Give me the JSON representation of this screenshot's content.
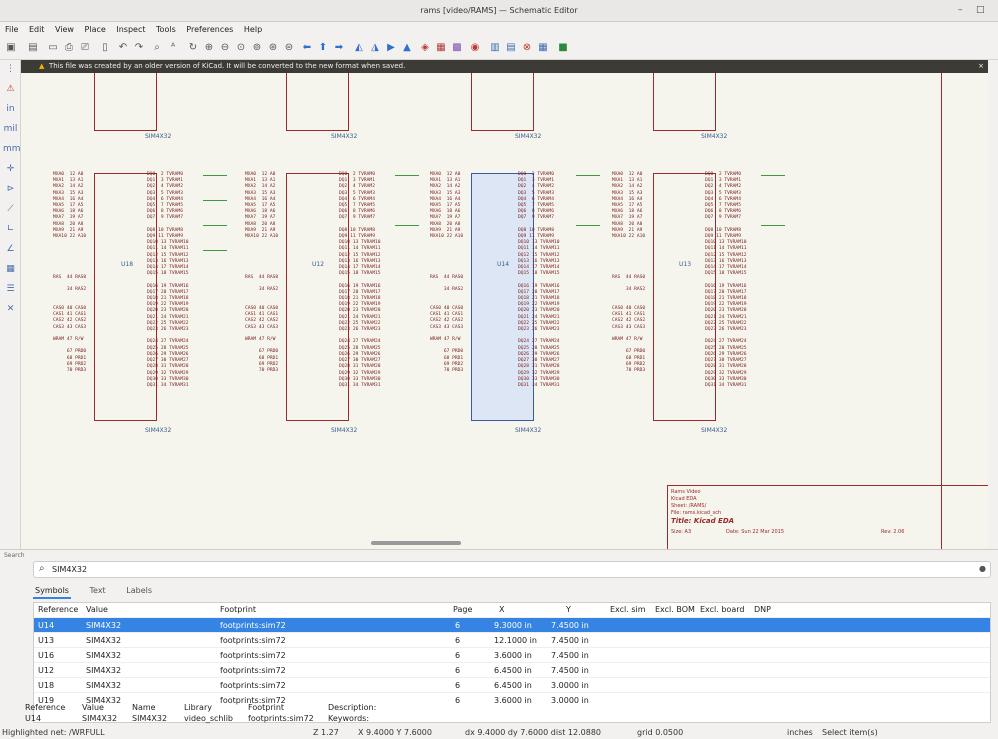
{
  "window": {
    "title": "rams [video/RAMS] — Schematic Editor",
    "minimize": "–",
    "maximize": "□"
  },
  "menu": [
    "File",
    "Edit",
    "View",
    "Place",
    "Inspect",
    "Tools",
    "Preferences",
    "Help"
  ],
  "warning": {
    "text": "This file was created by an older version of KiCad. It will be converted to the new format when saved.",
    "close": "×",
    "icon": "warning-icon"
  },
  "components": [
    {
      "ref": "U18",
      "value": "SIM4X32"
    },
    {
      "ref": "U12",
      "value": "SIM4X32"
    },
    {
      "ref": "U14",
      "value": "SIM4X32"
    },
    {
      "ref": "U13",
      "value": "SIM4X32"
    }
  ],
  "top_labels": [
    "SIM4X32",
    "SIM4X32",
    "SIM4X32",
    "SIM4X32"
  ],
  "titleblock": {
    "company": "Rams Video",
    "comment": "Kicad EDA",
    "sheet": "Sheet: /RAMS/",
    "file": "File: rams.kicad_sch",
    "title": "Title: Kicad EDA",
    "size": "Size: A3",
    "date": "Date: Sun 22 Mar 2015",
    "rev": "Rev: 2.06"
  },
  "search": {
    "header": "Search",
    "query": "SIM4X32",
    "tabs": [
      "Symbols",
      "Text",
      "Labels"
    ],
    "active_tab": "Symbols"
  },
  "table": {
    "columns": [
      "Reference",
      "Value",
      "Footprint",
      "Page",
      "X",
      "Y",
      "Excl. sim",
      "Excl. BOM",
      "Excl. board",
      "DNP"
    ],
    "rows": [
      [
        "U14",
        "SIM4X32",
        "footprints:sim72",
        "6",
        "9.3000 in",
        "7.4500 in"
      ],
      [
        "U13",
        "SIM4X32",
        "footprints:sim72",
        "6",
        "12.1000 in",
        "7.4500 in"
      ],
      [
        "U16",
        "SIM4X32",
        "footprints:sim72",
        "6",
        "3.6000 in",
        "7.4500 in"
      ],
      [
        "U12",
        "SIM4X32",
        "footprints:sim72",
        "6",
        "6.4500 in",
        "7.4500 in"
      ],
      [
        "U18",
        "SIM4X32",
        "footprints:sim72",
        "6",
        "6.4500 in",
        "3.0000 in"
      ],
      [
        "U19",
        "SIM4X32",
        "footprints:sim72",
        "6",
        "3.6000 in",
        "3.0000 in"
      ]
    ]
  },
  "props": {
    "labels": [
      "Reference",
      "Value",
      "Name",
      "Library",
      "Footprint",
      "Description:"
    ],
    "values": [
      "U14",
      "SIM4X32",
      "SIM4X32",
      "video_schlib",
      "footprints:sim72",
      "Keywords:"
    ]
  },
  "status": {
    "net": "Highlighted net: /WRFULL",
    "zoom": "Z 1.27",
    "xy": "X 9.4000 Y 7.6000",
    "delta": "dx 9.4000 dy 7.6000 dist 12.0880",
    "grid": "grid 0.0500",
    "units": "inches",
    "mode": "Select item(s)"
  },
  "pins_left": "MXA0  12 A0\nMXA1  13 A1\nMXA2  14 A2\nMXA3  15 A3\nMXA4  16 A4\nMXA5  17 A5\nMXA6  18 A6\nMXA7  19 A7\nMXA8  20 A8\nMXA9  21 A9\nMXA10 22 A10",
  "pins_right": "DQ0  2 TVRAM0\nDQ1  3 TVRAM1\nDQ2  4 TVRAM2\nDQ3  5 TVRAM3\nDQ4  6 TVRAM4\nDQ5  7 TVRAM5\nDQ6  8 TVRAM6\nDQ7  9 TVRAM7\n\nDQ8 10 TVRAM8\nDQ9 11 TVRAM9\nDQ10 13 TVRAM10\nDQ11 14 TVRAM11\nDQ12 15 TVRAM12\nDQ13 16 TVRAM13\nDQ14 17 TVRAM14\nDQ15 18 TVRAM15\n\nDQ16 19 TVRAM16\nDQ17 20 TVRAM17\nDQ18 21 TVRAM18\nDQ19 22 TVRAM19\nDQ20 23 TVRAM20\nDQ21 24 TVRAM21\nDQ22 25 TVRAM22\nDQ23 26 TVRAM23\n\nDQ24 27 TVRAM24\nDQ25 28 TVRAM25\nDQ26 29 TVRAM26\nDQ27 30 TVRAM27\nDQ28 31 TVRAM28\nDQ29 32 TVRAM29\nDQ30 33 TVRAM30\nDQ31 34 TVRAM31",
  "pins_ctrl": "RAS  44 RAS0\n\n     34 RAS2\n\n\nCAS0 40 CAS0\nCAS1 41 CAS1\nCAS2 42 CAS2\nCAS3 43 CAS3\n\nWRAM 47 R/W\n\n     67 PRD0\n     68 PRD1\n     69 PRD2\n     70 PRD3"
}
